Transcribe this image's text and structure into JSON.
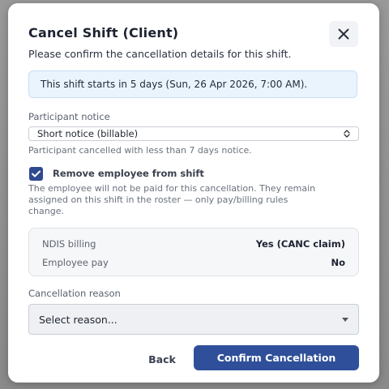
{
  "dialog": {
    "title": "Cancel Shift (Client)",
    "subtitle": "Please confirm the cancellation details for this shift.",
    "close_icon": "close-icon"
  },
  "banner": {
    "text": "This shift starts in 5 days (Sun, 26 Apr 2026, 7:00 AM)."
  },
  "participant_notice": {
    "label": "Participant notice",
    "selected": "Short notice (billable)",
    "help": "Participant cancelled with less than 7 days notice."
  },
  "remove_employee": {
    "checked": true,
    "label": "Remove employee from shift",
    "help_line1": "The employee will not be paid for this cancellation. They remain",
    "help_line2": "assigned on this shift in the roster — only pay/billing rules",
    "help_line3": "change."
  },
  "summary": {
    "rows": [
      {
        "key": "NDIS billing",
        "value": "Yes (CANC claim)"
      },
      {
        "key": "Employee pay",
        "value": "No"
      }
    ]
  },
  "cancellation_reason": {
    "label": "Cancellation reason",
    "placeholder": "Select reason..."
  },
  "actions": {
    "back_label": "Back",
    "confirm_label": "Confirm Cancellation"
  },
  "colors": {
    "primary": "#2f4f9a",
    "checkbox": "#2f4a8e",
    "info_bg": "#eaf4fd"
  }
}
